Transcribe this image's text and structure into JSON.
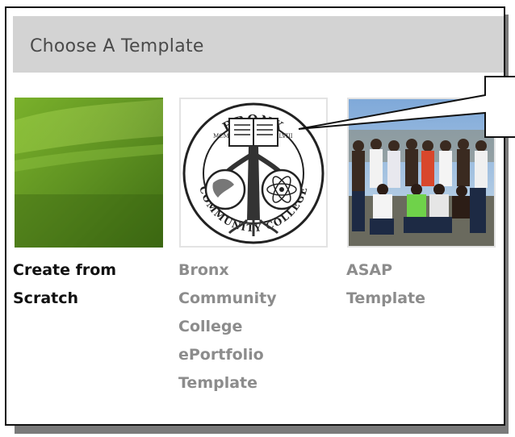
{
  "dialog": {
    "title": "Choose A Template"
  },
  "templates": [
    {
      "label": "Create from Scratch",
      "image": "green-gradient-thumbnail"
    },
    {
      "label": "Bronx Community College ePortfolio Template",
      "image": "bronx-community-college-seal"
    },
    {
      "label": "ASAP Template",
      "image": "asap-group-photo"
    }
  ],
  "seal": {
    "top_text": "BRONX",
    "bottom_text": "COMMUNITY COLLEGE",
    "left_numeral": "MCM",
    "right_numeral": "LVIII"
  },
  "colors": {
    "header_bg": "#d3d3d3",
    "accent_green": "#5f8f1e",
    "inactive_label": "#8c8c8c"
  }
}
